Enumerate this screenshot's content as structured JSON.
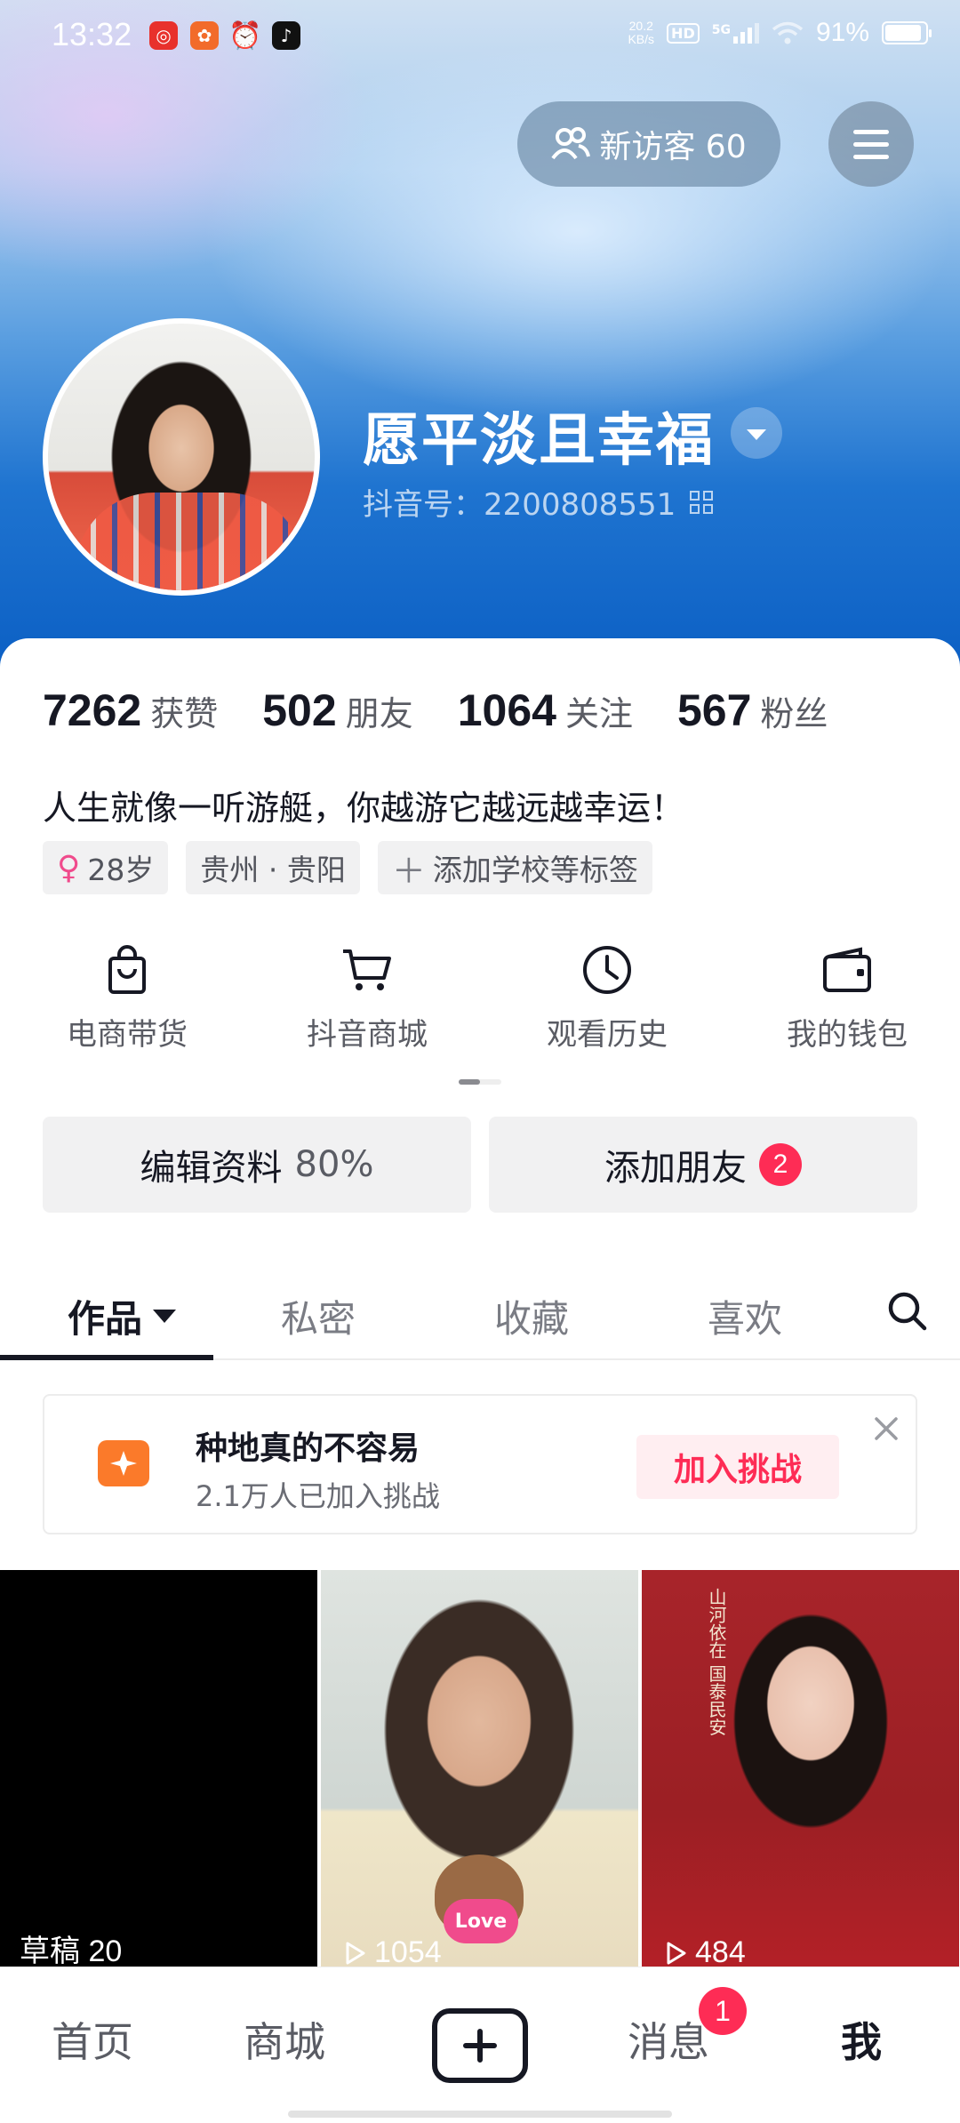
{
  "status_bar": {
    "time": "13:32",
    "net_speed_top": "20.2",
    "net_speed_bottom": "KB/s",
    "hd": "HD",
    "network": "5G",
    "battery": "91%",
    "battery_level": 0.91,
    "app_icons": [
      "netease-music-icon",
      "app-grid-icon",
      "alarm-icon",
      "tiktok-icon"
    ]
  },
  "header": {
    "visitors_label": "新访客 60",
    "username": "愿平淡且幸福",
    "douyin_id": "抖音号：2200808551"
  },
  "stats": [
    {
      "num": "7262",
      "label": "获赞"
    },
    {
      "num": "502",
      "label": "朋友"
    },
    {
      "num": "1064",
      "label": "关注"
    },
    {
      "num": "567",
      "label": "粉丝"
    }
  ],
  "bio": "人生就像一听游艇，你越游它越远越幸运！",
  "tags": {
    "age": "28岁",
    "location": "贵州 · 贵阳",
    "add_tag": "添加学校等标签"
  },
  "features": [
    {
      "label": "电商带货",
      "icon": "shopping-bag-icon"
    },
    {
      "label": "抖音商城",
      "icon": "cart-icon"
    },
    {
      "label": "观看历史",
      "icon": "clock-icon"
    },
    {
      "label": "我的钱包",
      "icon": "wallet-icon"
    }
  ],
  "buttons": {
    "edit_profile": "编辑资料",
    "edit_percent": "80%",
    "add_friend": "添加朋友",
    "add_friend_badge": "2"
  },
  "tabs": [
    "作品",
    "私密",
    "收藏",
    "喜欢"
  ],
  "challenge": {
    "title": "种地真的不容易",
    "subtitle": "2.1万人已加入挑战",
    "join_label": "加入挑战"
  },
  "videos": [
    {
      "meta": "草稿 20"
    },
    {
      "meta": "1054",
      "sticker": "Love"
    },
    {
      "meta": "484",
      "calligraphy": "山河依在 国泰民安"
    }
  ],
  "bottom_nav": {
    "home": "首页",
    "mall": "商城",
    "messages": "消息",
    "messages_badge": "1",
    "me": "我"
  },
  "colors": {
    "accent": "#fe2c55",
    "text_primary": "#161823",
    "text_secondary": "#5a5c64"
  }
}
